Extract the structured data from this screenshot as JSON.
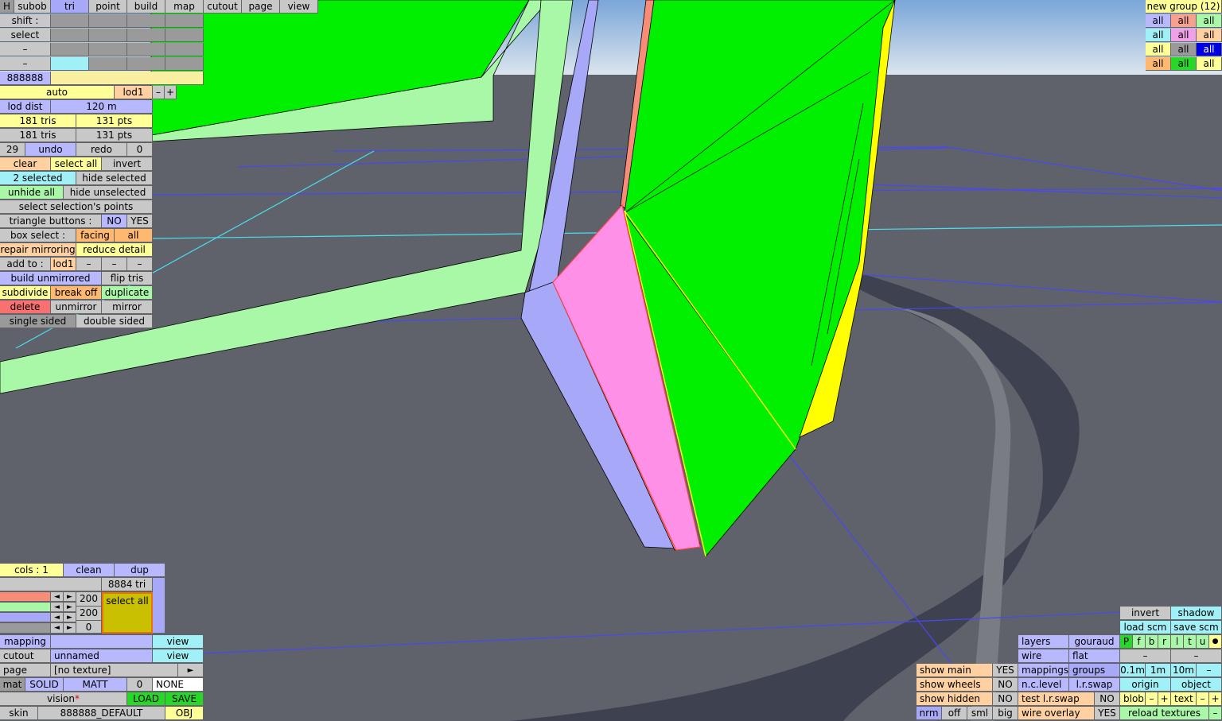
{
  "top_tabs": {
    "h": "H",
    "subob": "subob",
    "tri": "tri",
    "point": "point",
    "build": "build",
    "map": "map",
    "cutout": "cutout",
    "page": "page",
    "view": "view"
  },
  "top_left": {
    "shift": "shift :",
    "select": "select",
    "dash1": "–",
    "dash2": "–",
    "color_code": "888888"
  },
  "lod": {
    "auto": "auto",
    "lod1": "lod1",
    "minus": "–",
    "plus": "+",
    "lod_dist_label": "lod dist",
    "lod_dist_value": "120 m"
  },
  "counts": {
    "tris1": "181 tris",
    "pts1": "131 pts",
    "tris2": "181 tris",
    "pts2": "131 pts"
  },
  "history": {
    "num": "29",
    "undo": "undo",
    "redo": "redo",
    "redo_num": "0"
  },
  "tri_panel": {
    "clear": "clear",
    "select_all": "select all",
    "invert": "invert",
    "selected": "2 selected",
    "hide_selected": "hide selected",
    "unhide_all": "unhide all",
    "hide_unselected": "hide unselected",
    "select_points": "select selection's points",
    "triangle_buttons": "triangle buttons :",
    "no": "NO",
    "yes": "YES",
    "box_select": "box select :",
    "facing": "facing",
    "all": "all",
    "repair_mirroring": "repair mirroring",
    "reduce_detail": "reduce detail",
    "add_to": "add to :",
    "add_lod1": "lod1",
    "dash": "–",
    "build_unmirrored": "build unmirrored",
    "flip_tris": "flip tris",
    "subdivide": "subdivide",
    "break_off": "break off",
    "duplicate": "duplicate",
    "delete": "delete",
    "unmirror": "unmirror",
    "mirror": "mirror",
    "single_sided": "single sided",
    "double_sided": "double sided"
  },
  "groups": {
    "title": "new group (12)",
    "all": "all"
  },
  "bottom_left": {
    "cols": "cols : 1",
    "clean": "clean",
    "dup": "dup",
    "tri_count": "8884 tri",
    "val1": "200",
    "val2": "200",
    "val3": "0",
    "select_all": "select all",
    "mapping": "mapping",
    "view": "view",
    "cutout": "cutout",
    "unnamed": "unnamed",
    "page": "page",
    "no_texture": "[no texture]",
    "arrow": "►",
    "mat": "mat",
    "solid": "SOLID",
    "matt": "MATT",
    "mat_num": "0",
    "none": "NONE",
    "vision": "vision",
    "star": "*",
    "load": "LOAD",
    "save": "SAVE",
    "skin": "skin",
    "skin_name": "888888_DEFAULT",
    "obj": "OBJ"
  },
  "bottom_right": {
    "invert": "invert",
    "shadow": "shadow",
    "load_scm": "load scm",
    "save_scm": "save scm",
    "layers": "layers",
    "gouraud": "gouraud",
    "wire": "wire",
    "flat": "flat",
    "letters": [
      "P",
      "f",
      "b",
      "r",
      "l",
      "t",
      "u",
      "●"
    ],
    "mappings": "mappings",
    "groups": "groups",
    "d01": "0.1m",
    "d1": "1m",
    "d10": "10m",
    "dash": "–",
    "show_main": "show main",
    "show_wheels": "show wheels",
    "show_hidden": "show hidden",
    "yes": "YES",
    "no": "NO",
    "nc_level": "n.c.level",
    "lr_swap": "l.r.swap",
    "origin": "origin",
    "object": "object",
    "test_lr_swap": "test l.r.swap",
    "blob": "blob",
    "minus": "–",
    "plus": "+",
    "text": "text",
    "nrm": "nrm",
    "off": "off",
    "sml": "sml",
    "big": "big",
    "wire_overlay": "wire overlay",
    "reload_textures": "reload textures"
  },
  "colors": {
    "sky": "#b8c8d8",
    "ground": "#5f626a",
    "mesh_green": "#00f000",
    "mesh_yellow": "#ffff00",
    "mesh_pink": "#ff90e8",
    "mesh_salmon": "#f88c78",
    "mesh_lavender": "#a8a8f8",
    "mesh_lightgreen": "#a8f8a8",
    "wire_blue": "#4848f0",
    "wire_cyan": "#48e0f0"
  }
}
